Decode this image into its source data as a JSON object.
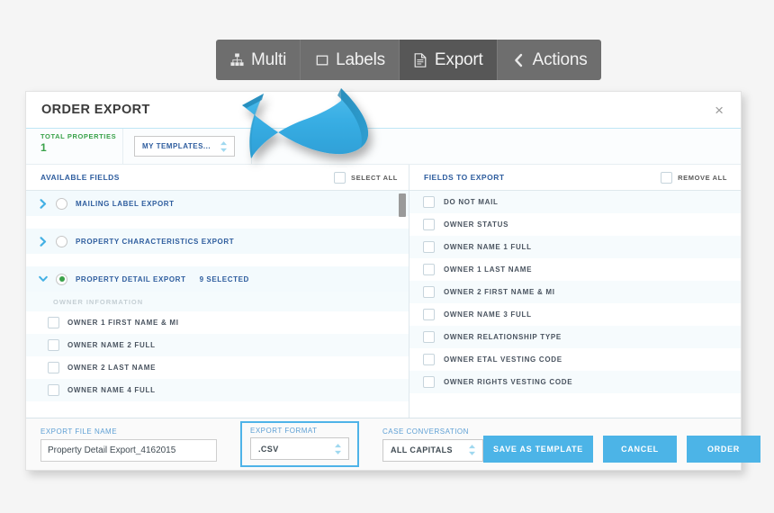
{
  "tabs": [
    {
      "label": "Multi",
      "icon": "org-chart-icon",
      "active": false
    },
    {
      "label": "Labels",
      "icon": "square-icon",
      "active": false
    },
    {
      "label": "Export",
      "icon": "document-icon",
      "active": true
    },
    {
      "label": "Actions",
      "icon": "chevron-left-icon",
      "active": false
    }
  ],
  "dialog": {
    "title": "ORDER EXPORT",
    "close_label": "×",
    "total_properties_label": "TOTAL PROPERTIES",
    "total_properties_value": "1",
    "templates_select": "MY TEMPLATES..."
  },
  "available_panel": {
    "title": "AVAILABLE FIELDS",
    "select_all_label": "SELECT ALL",
    "groups": [
      {
        "label": "MAILING LABEL EXPORT",
        "count": "",
        "expanded": false,
        "selected": false
      },
      {
        "label": "PROPERTY CHARACTERISTICS EXPORT",
        "count": "",
        "expanded": false,
        "selected": false
      },
      {
        "label": "PROPERTY DETAIL EXPORT",
        "count": "9 SELECTED",
        "expanded": true,
        "selected": true
      }
    ],
    "section_label": "OWNER INFORMATION",
    "fields": [
      "OWNER 1 FIRST NAME & MI",
      "OWNER NAME 2 FULL",
      "OWNER 2 LAST NAME",
      "OWNER NAME 4 FULL"
    ]
  },
  "export_panel": {
    "title": "FIELDS TO EXPORT",
    "remove_all_label": "REMOVE ALL",
    "fields": [
      "DO NOT MAIL",
      "OWNER STATUS",
      "OWNER NAME 1 FULL",
      "OWNER 1 LAST NAME",
      "OWNER 2 FIRST NAME & MI",
      "OWNER NAME 3 FULL",
      "OWNER RELATIONSHIP TYPE",
      "OWNER ETAL VESTING CODE",
      "OWNER RIGHTS VESTING CODE"
    ]
  },
  "footer": {
    "export_file_name_label": "EXPORT FILE NAME",
    "export_file_name_value": "Property Detail Export_4162015",
    "export_file_name_placeholder": "Export file name",
    "export_format_label": "EXPORT FORMAT",
    "export_format_value": ".CSV",
    "case_conversation_label": "CASE CONVERSATION",
    "case_conversation_value": "ALL CAPITALS",
    "save_as_template_label": "SAVE AS TEMPLATE",
    "cancel_label": "CANCEL",
    "order_label": "ORDER"
  },
  "colors": {
    "accent_blue": "#4cb4e7",
    "link_blue": "#2e5d9e",
    "green": "#3aa24a",
    "tab_inactive": "#6e6e6e",
    "tab_active": "#575757",
    "arrow_blue": "#37a9e0"
  }
}
